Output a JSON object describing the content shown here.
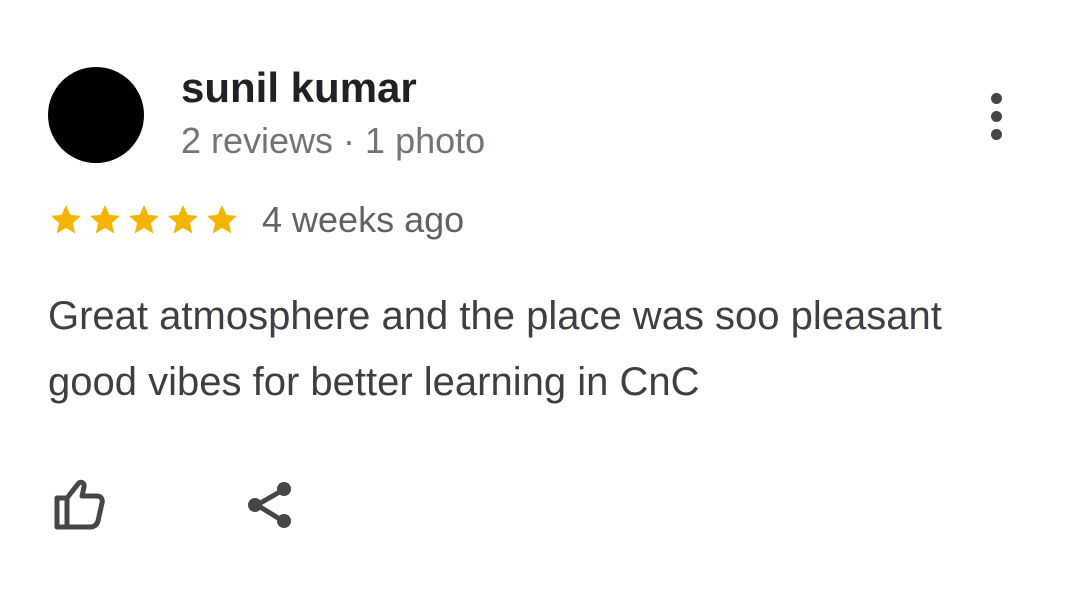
{
  "review": {
    "author_name": "sunil kumar",
    "author_meta": "2 reviews · 1 photo",
    "rating": 5,
    "rating_max": 5,
    "time_ago": "4 weeks ago",
    "text": "Great atmosphere and the place was soo pleasant good vibes for better learning in CnC"
  },
  "icons": {
    "avatar": "avatar",
    "more": "more-vert-icon",
    "star": "star-icon",
    "like": "thumb-up-icon",
    "share": "share-icon"
  },
  "colors": {
    "star": "#F5B400",
    "name": "#202124",
    "meta": "#70757A",
    "body_text": "#3C4043",
    "icon": "#444746"
  }
}
